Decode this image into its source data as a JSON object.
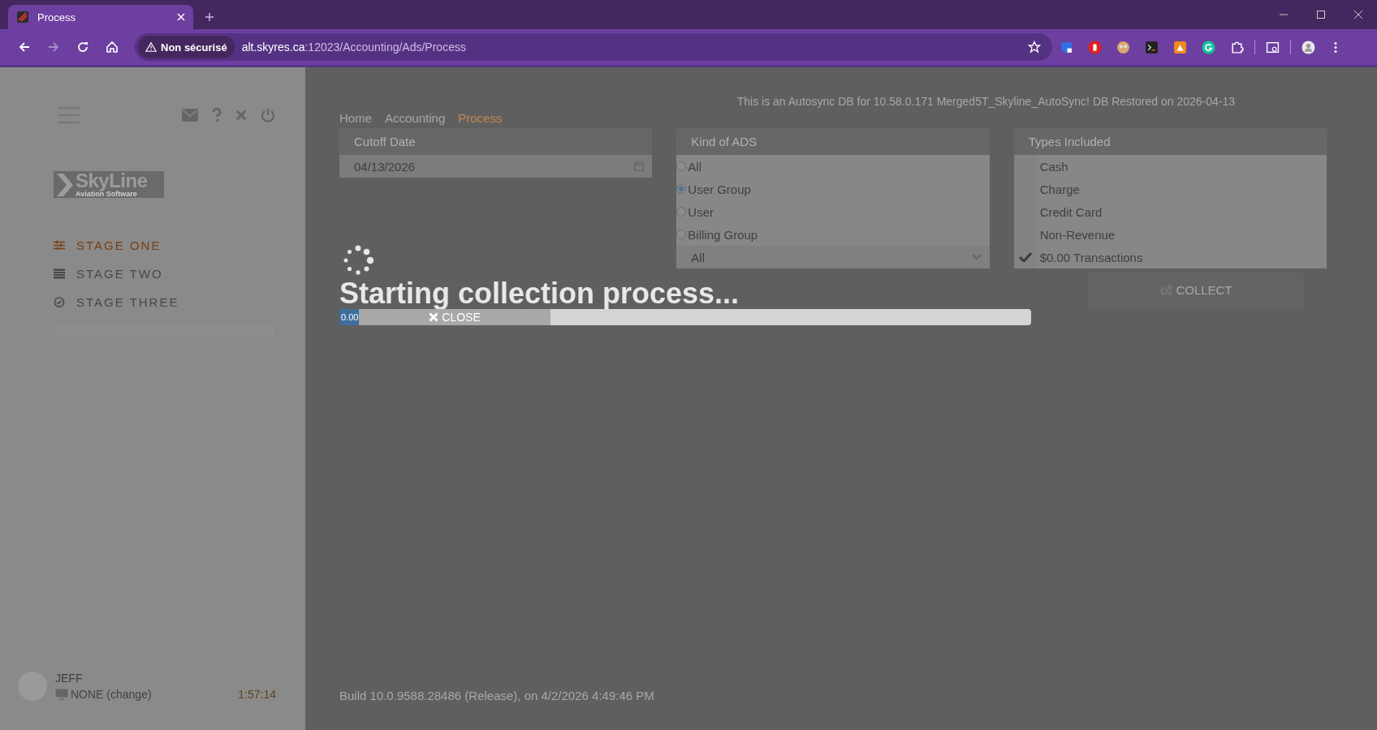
{
  "browser": {
    "tab": {
      "title": "Process"
    },
    "security_chip": "Non sécurisé",
    "url": {
      "host": "alt.skyres.ca",
      "path": ":12023/Accounting/Ads/Process"
    }
  },
  "sidebar": {
    "logo": {
      "name": "SkyLine",
      "tagline": "Aviation Software"
    },
    "stages": [
      {
        "label": "STAGE ONE",
        "selected": true,
        "kind": "sliders"
      },
      {
        "label": "STAGE TWO",
        "selected": false,
        "kind": "list"
      },
      {
        "label": "STAGE THREE",
        "selected": false,
        "kind": "check"
      }
    ],
    "user": {
      "name": "JEFF",
      "terminal": "NONE (change)",
      "time": "1:57:14"
    }
  },
  "header_notice": "This is an Autosync DB for 10.58.0.171 Merged5T_Skyline_AutoSync! DB Restored on 2026-04-13",
  "breadcrumb": [
    {
      "label": "Home",
      "selected": false
    },
    {
      "label": "Accounting",
      "selected": false
    },
    {
      "label": "Process",
      "selected": true
    }
  ],
  "cutoff": {
    "title": "Cutoff Date",
    "value": "04/13/2026"
  },
  "kind_of_ads": {
    "title": "Kind of ADS",
    "options": [
      {
        "label": "All",
        "selected": false
      },
      {
        "label": "User Group",
        "selected": true
      },
      {
        "label": "User",
        "selected": false
      },
      {
        "label": "Billing Group",
        "selected": false
      }
    ],
    "select_value": "All"
  },
  "types_included": {
    "title": "Types Included",
    "items": [
      {
        "label": "Cash",
        "checked": false
      },
      {
        "label": "Charge",
        "checked": false
      },
      {
        "label": "Credit Card",
        "checked": false
      },
      {
        "label": "Non-Revenue",
        "checked": false
      },
      {
        "label": "$0.00 Transactions",
        "checked": true
      }
    ]
  },
  "collect_button": "COLLECT",
  "overlay": {
    "message": "Starting collection process...",
    "progress": {
      "level": 0.03,
      "reading": "0.00"
    },
    "close_button": "CLOSE"
  },
  "build": "Build 10.0.9588.28486 (Release), on 4/2/2026 4:49:46 PM"
}
